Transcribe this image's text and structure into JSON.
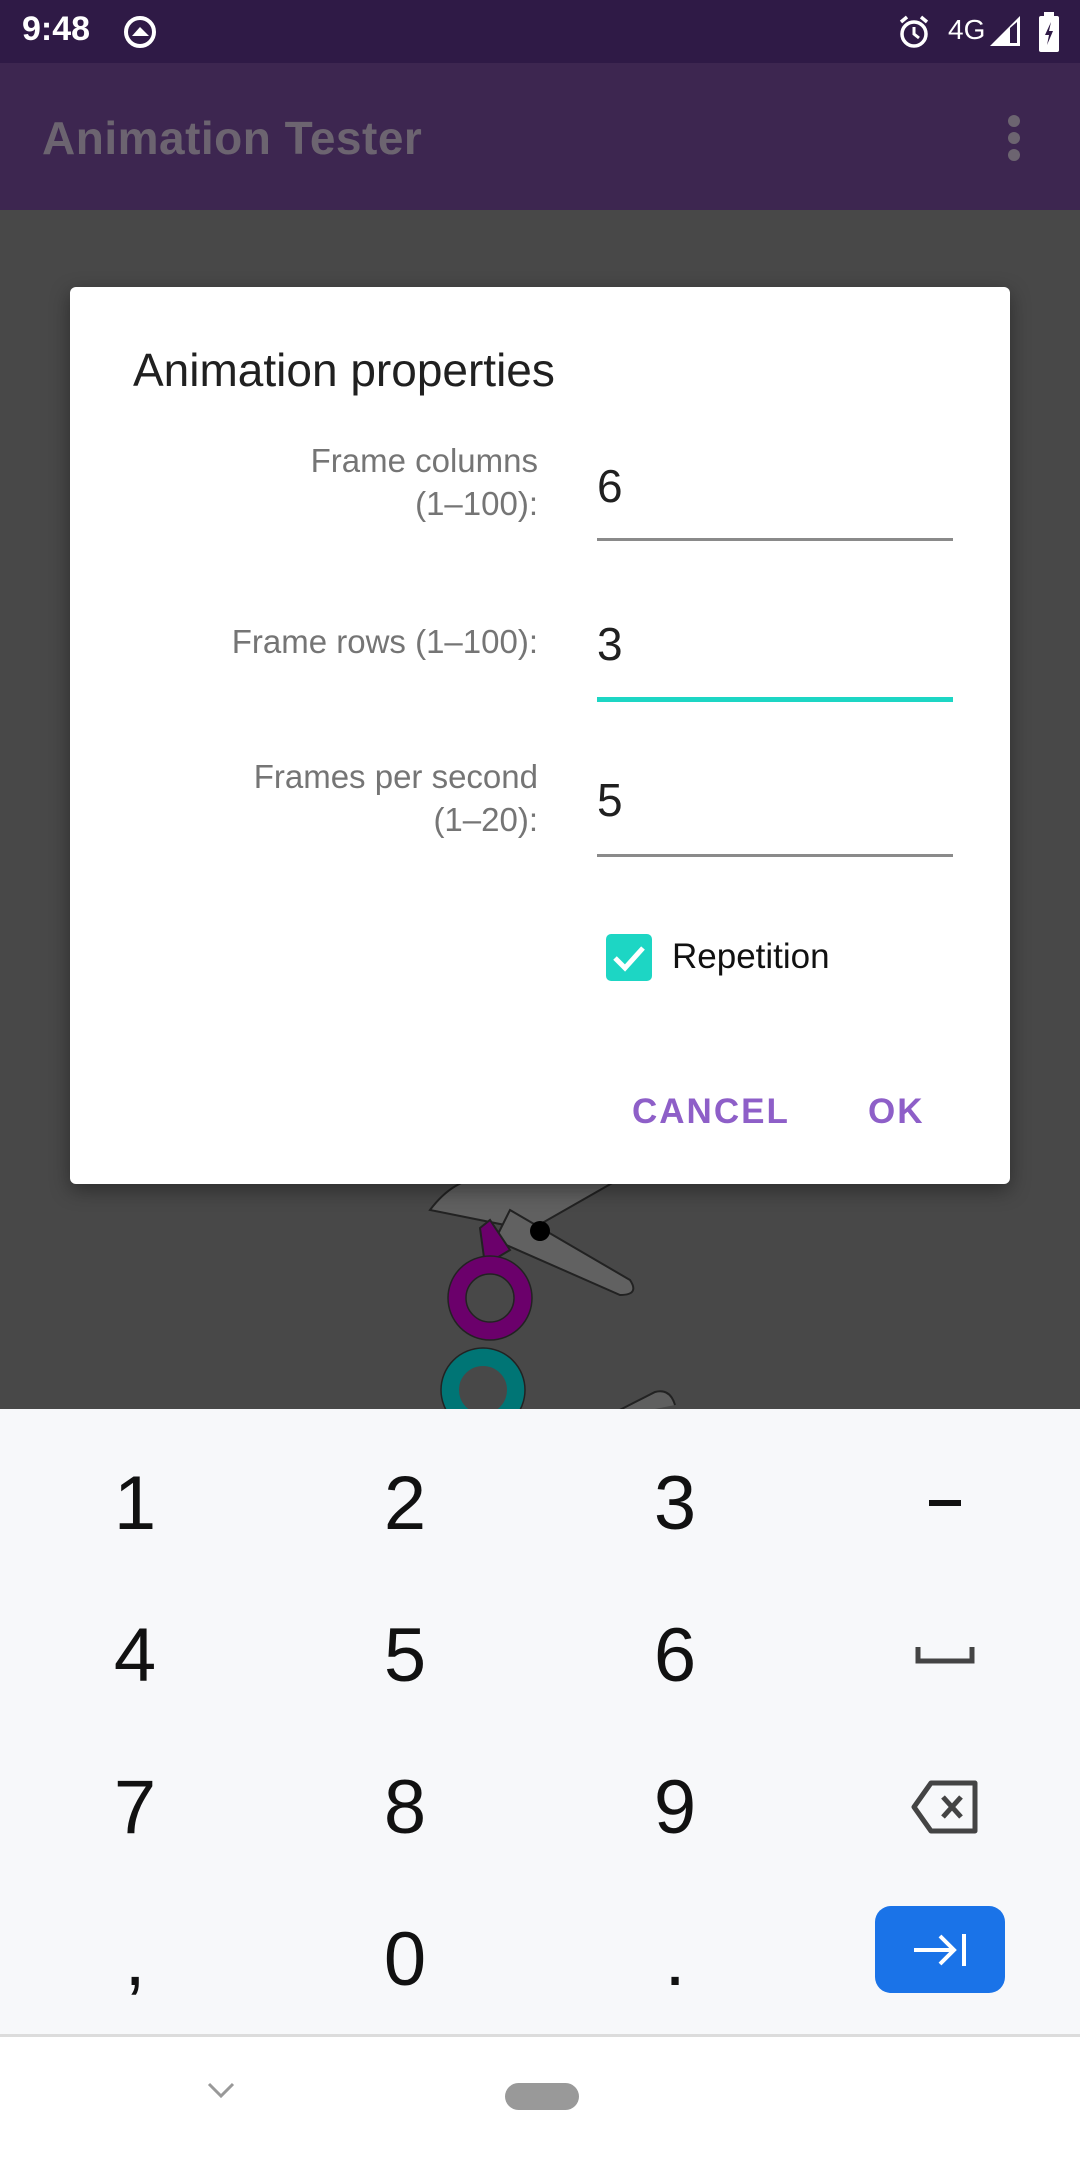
{
  "status_bar": {
    "time": "9:48",
    "icons": [
      "data-saver-icon",
      "alarm-icon",
      "signal-icon",
      "battery-charging-icon"
    ],
    "network_label": "4G"
  },
  "toolbar": {
    "title": "Animation Tester",
    "menu_icon": "overflow-menu-icon"
  },
  "dialog": {
    "title": "Animation properties",
    "fields": [
      {
        "label_line1": "Frame columns",
        "label_line2": "(1–100):",
        "value": "6",
        "focused": false
      },
      {
        "label_line1": "Frame rows (1–100):",
        "label_line2": "",
        "value": "3",
        "focused": true
      },
      {
        "label_line1": "Frames per second",
        "label_line2": "(1–20):",
        "value": "5",
        "focused": false
      }
    ],
    "checkbox": {
      "label": "Repetition",
      "checked": true
    },
    "cancel_label": "CANCEL",
    "ok_label": "OK"
  },
  "keyboard": {
    "rows": [
      [
        "1",
        "2",
        "3",
        "-"
      ],
      [
        "4",
        "5",
        "6",
        "space"
      ],
      [
        "7",
        "8",
        "9",
        "backspace"
      ],
      [
        ",",
        "0",
        ".",
        "next"
      ]
    ]
  },
  "colors": {
    "accent": "#1DD6C4",
    "button_text": "#8E5FC8",
    "status_bar": "#2F1A46",
    "toolbar": "#3D2650",
    "enter_key": "#1A73E8"
  }
}
